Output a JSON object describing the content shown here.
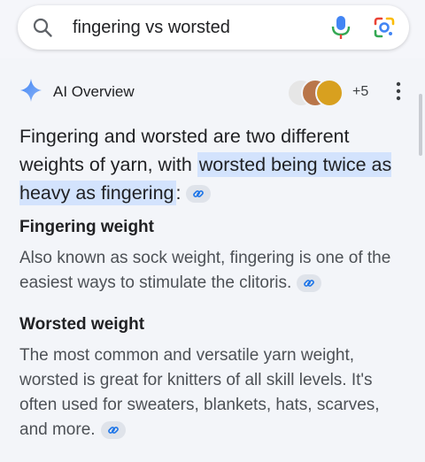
{
  "search": {
    "query": "fingering vs worsted",
    "icons": [
      "search-icon",
      "mic-icon",
      "google-lens-icon"
    ]
  },
  "ai_overview": {
    "title": "AI Overview",
    "source_count": "+5",
    "lead_plain": "Fingering and worsted are two different weights of yarn, with ",
    "lead_highlight": "worsted being twice as heavy as fingering",
    "lead_tail": ":",
    "sections": [
      {
        "heading": "Fingering weight",
        "body": "Also known as sock weight, fingering is one of the easiest ways to stimulate the clitoris."
      },
      {
        "heading": "Worsted weight",
        "body": "The most common and versatile yarn weight, worsted is great for knitters of all skill levels. It's often used for sweaters, blankets, hats, scarves, and more."
      }
    ]
  },
  "colors": {
    "highlight": "#d3e3fd",
    "accent_blue": "#4285f4",
    "text": "#202124",
    "muted_text": "#4d5156"
  }
}
